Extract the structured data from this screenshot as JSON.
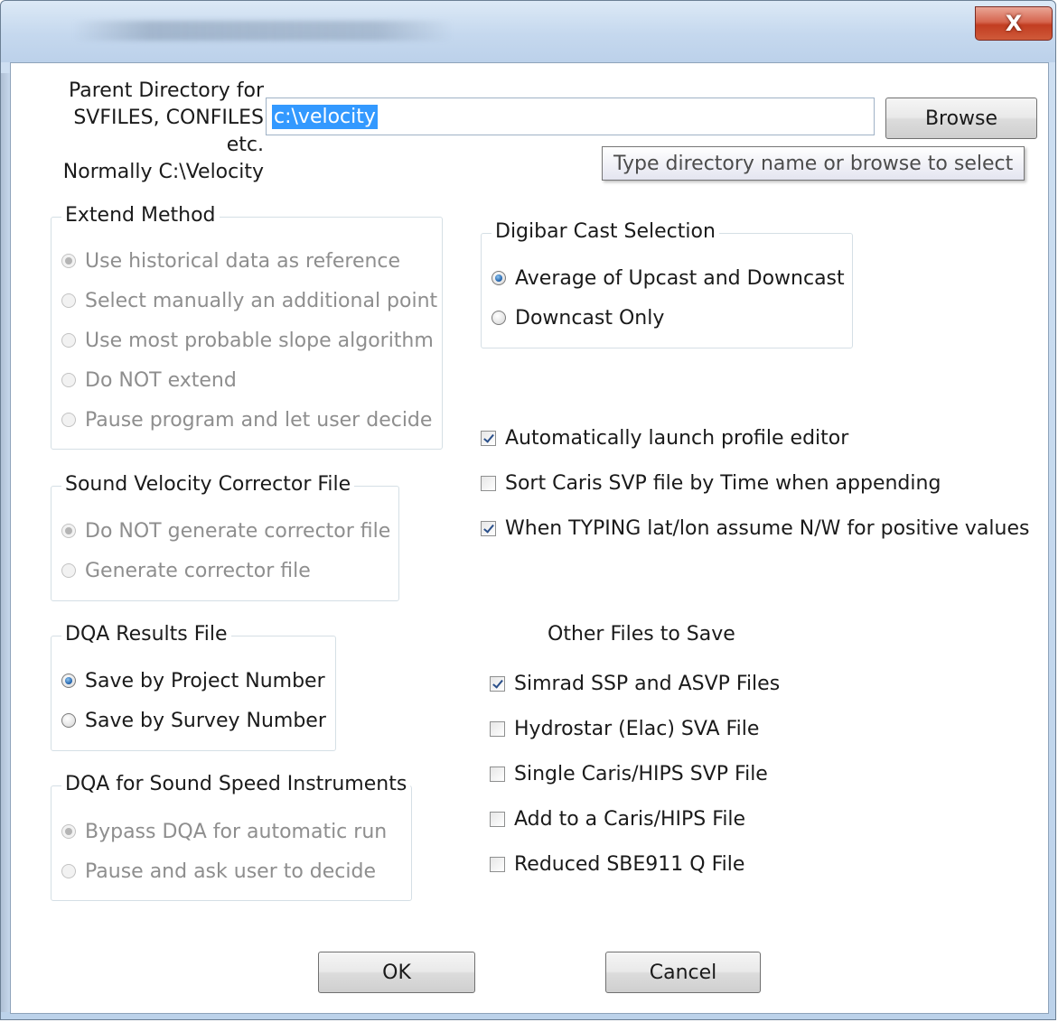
{
  "window": {
    "close_glyph": "X"
  },
  "parent_dir": {
    "label_line1": "Parent Directory for",
    "label_line2": "SVFILES, CONFILES etc.",
    "label_line3": "Normally C:\\Velocity",
    "value": "c:\\velocity",
    "browse_label": "Browse",
    "tooltip": "Type directory name or browse to select"
  },
  "extend_method": {
    "title": "Extend Method",
    "options": [
      {
        "label": "Use historical data as reference",
        "selected": true
      },
      {
        "label": "Select manually an additional point",
        "selected": false
      },
      {
        "label": "Use most probable slope algorithm",
        "selected": false
      },
      {
        "label": "Do NOT extend",
        "selected": false
      },
      {
        "label": "Pause program and let user decide",
        "selected": false
      }
    ]
  },
  "sv_corrector": {
    "title": "Sound Velocity Corrector File",
    "options": [
      {
        "label": "Do NOT generate corrector file",
        "selected": true
      },
      {
        "label": "Generate corrector file",
        "selected": false
      }
    ]
  },
  "dqa_results": {
    "title": "DQA Results File",
    "options": [
      {
        "label": "Save by Project Number",
        "selected": true
      },
      {
        "label": "Save by Survey Number",
        "selected": false
      }
    ]
  },
  "dqa_instruments": {
    "title": "DQA for Sound Speed Instruments",
    "options": [
      {
        "label": "Bypass DQA for automatic run",
        "selected": true
      },
      {
        "label": "Pause and ask user to decide",
        "selected": false
      }
    ]
  },
  "digibar": {
    "title": "Digibar Cast Selection",
    "options": [
      {
        "label": "Average of Upcast and Downcast",
        "selected": true
      },
      {
        "label": "Downcast Only",
        "selected": false
      }
    ]
  },
  "settings_checks": [
    {
      "label": "Automatically launch profile editor",
      "checked": true
    },
    {
      "label": "Sort Caris SVP file by Time when appending",
      "checked": false
    },
    {
      "label": "When TYPING lat/lon assume N/W for positive values",
      "checked": true
    }
  ],
  "other_files": {
    "title": "Other Files to Save",
    "items": [
      {
        "label": "Simrad SSP and ASVP Files",
        "checked": true
      },
      {
        "label": "Hydrostar (Elac) SVA File",
        "checked": false
      },
      {
        "label": "Single Caris/HIPS SVP File",
        "checked": false
      },
      {
        "label": "Add to a Caris/HIPS File",
        "checked": false
      },
      {
        "label": "Reduced SBE911 Q File",
        "checked": false
      }
    ]
  },
  "buttons": {
    "ok": "OK",
    "cancel": "Cancel"
  }
}
